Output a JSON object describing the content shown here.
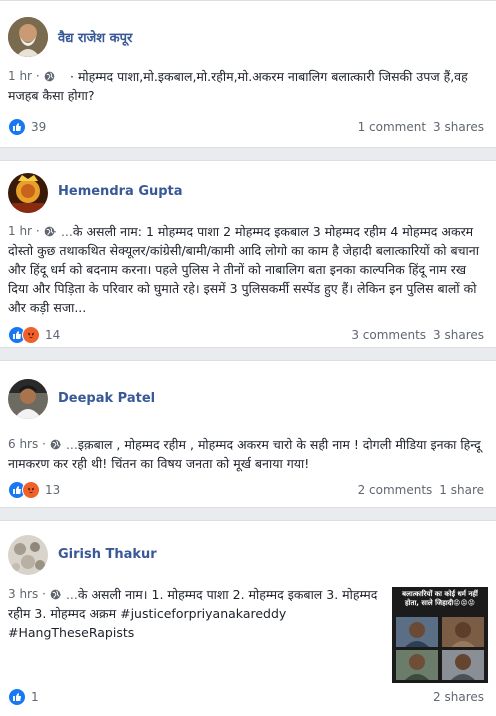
{
  "posts": [
    {
      "author": "वैद्य राजेश कपूर",
      "time": "1 hr",
      "lead": "",
      "text": "· मोहम्मद पाशा,मो.इकबाल,मो.रहीम,मो.अकरम नाबालिग बलात्कारी जिसकी उपज हैं,वह मजहब कैसा होगा?",
      "reactions": [
        "like"
      ],
      "reaction_count": "39",
      "comments": "1 comment",
      "shares": "3 shares"
    },
    {
      "author": "Hemendra Gupta",
      "time": "1 hr",
      "lead": "· ...",
      "text": "के असली नाम: 1 मोहम्मद पाशा 2 मोहम्मद इकबाल 3 मोहम्मद रहीम 4 मोहम्मद अकरम दोस्तो कुछ तथाकथित सेक्यूलर/कांग्रेसी/बामी/कामी आदि लोगो का काम है जेहादी बलात्कारियों को बचाना और हिंदू धर्म को बदनाम करना। पहले पुलिस ने तीनों को नाबालिग बता इनका काल्पनिक हिंदू नाम रख दिया और पिड़िता के परिवार को घुमाते रहे। इसमें 3 पुलिसकर्मी सस्पेंड हुए हैं। लेकिन इन पुलिस बालों को और कड़ी सजा...",
      "reactions": [
        "like",
        "angry"
      ],
      "reaction_count": "14",
      "comments": "3 comments",
      "shares": "3 shares"
    },
    {
      "author": "Deepak Patel",
      "time": "6 hrs",
      "lead": "· ...",
      "text": "इक़बाल , मोहम्मद रहीम , मोहम्मद अकरम चारो के सही नाम ! दोगली मीडिया इनका हिन्दू नामकरण कर रही थी! चिंतन का विषय जनता को मूर्ख बनाया गया!",
      "reactions": [
        "like",
        "angry"
      ],
      "reaction_count": "13",
      "comments": "2 comments",
      "shares": "1 share"
    },
    {
      "author": "Girish Thakur",
      "time": "3 hrs",
      "lead": "· ...",
      "text": "के असली नाम। 1. मोहम्मद पाशा 2. मोहम्मद इकबाल 3. मोहम्मद रहीम 3. मोहम्मद अक्रम #justiceforpriyanakareddy #HangTheseRapists",
      "reactions": [
        "like"
      ],
      "reaction_count": "1",
      "comments": "",
      "shares": "2 shares",
      "image_caption": "बलात्कारियों का कोई धर्म नहीं होता, साले जिहादी😡😡😡"
    }
  ],
  "colors": {
    "link": "#385898",
    "meta": "#606770",
    "like": "#1877f2",
    "angry": "#f0602b",
    "background": "#e9ebee"
  }
}
